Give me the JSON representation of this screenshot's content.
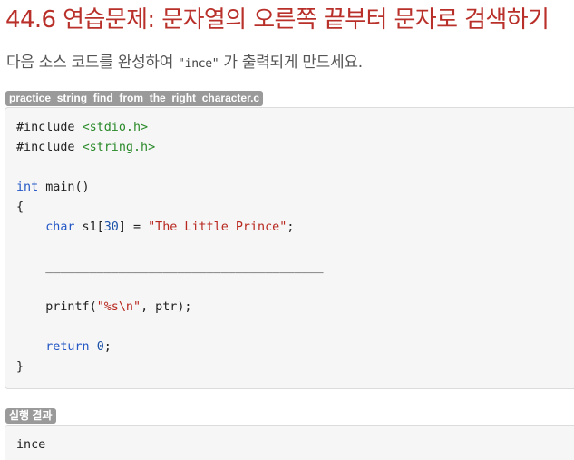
{
  "title": "44.6 연습문제: 문자열의 오른쪽 끝부터 문자로 검색하기",
  "description": {
    "before": "다음 소스 코드를 완성하여 ",
    "code": "\"ince\"",
    "after": " 가 출력되게 만드세요."
  },
  "source_file": {
    "label": "practice_string_find_from_the_right_character.c",
    "code_lines": [
      [
        {
          "t": "#include ",
          "c": ""
        },
        {
          "t": "<stdio.h>",
          "c": "inc"
        }
      ],
      [
        {
          "t": "#include ",
          "c": ""
        },
        {
          "t": "<string.h>",
          "c": "inc"
        }
      ],
      [],
      [
        {
          "t": "int",
          "c": "kw"
        },
        {
          "t": " main()",
          "c": ""
        }
      ],
      [
        {
          "t": "{",
          "c": ""
        }
      ],
      [
        {
          "t": "    ",
          "c": ""
        },
        {
          "t": "char",
          "c": "kw"
        },
        {
          "t": " s1[",
          "c": ""
        },
        {
          "t": "30",
          "c": "num"
        },
        {
          "t": "] = ",
          "c": ""
        },
        {
          "t": "\"The Little Prince\"",
          "c": "str"
        },
        {
          "t": ";",
          "c": ""
        }
      ],
      [],
      [
        {
          "t": "    ______________________________________",
          "c": ""
        }
      ],
      [],
      [
        {
          "t": "    printf(",
          "c": ""
        },
        {
          "t": "\"%s\\n\"",
          "c": "str"
        },
        {
          "t": ", ptr);",
          "c": ""
        }
      ],
      [],
      [
        {
          "t": "    ",
          "c": ""
        },
        {
          "t": "return",
          "c": "kw"
        },
        {
          "t": " ",
          "c": ""
        },
        {
          "t": "0",
          "c": "num"
        },
        {
          "t": ";",
          "c": ""
        }
      ],
      [
        {
          "t": "}",
          "c": ""
        }
      ]
    ]
  },
  "result": {
    "label": "실행 결과",
    "code_lines": [
      [
        {
          "t": "ince",
          "c": ""
        }
      ]
    ]
  }
}
